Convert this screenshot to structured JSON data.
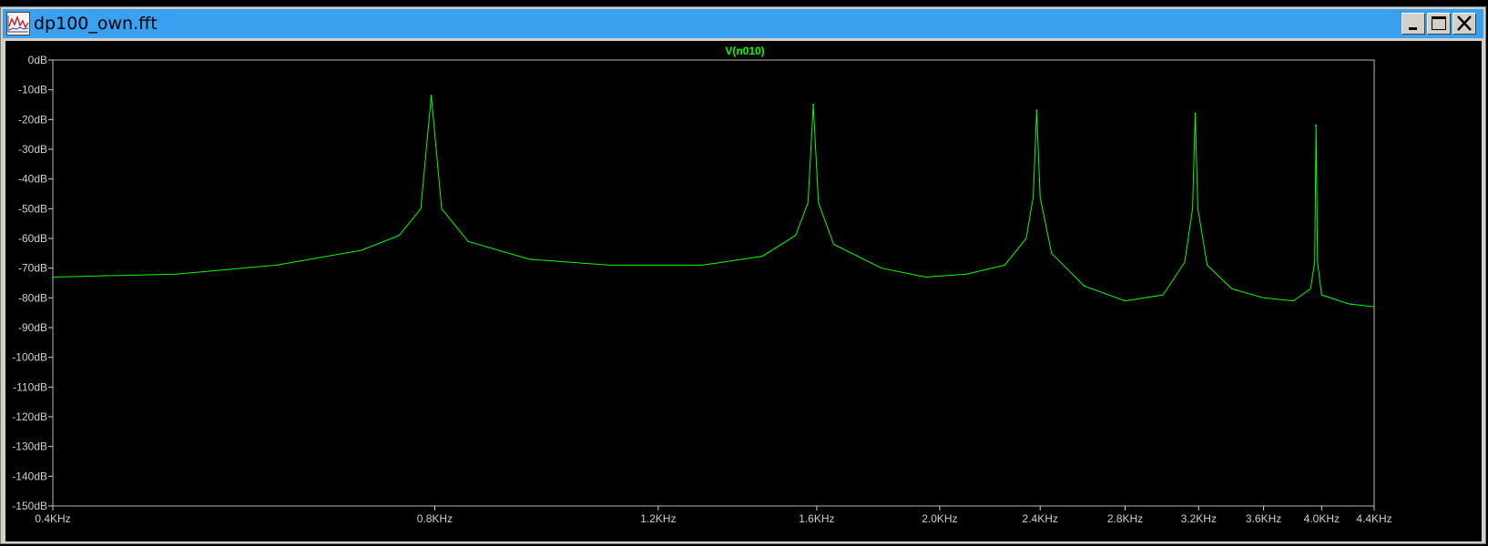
{
  "window": {
    "title": "dp100_own.fft",
    "buttons": {
      "minimize": "minimize",
      "maximize": "maximize",
      "close": "close"
    }
  },
  "colors": {
    "trace": "#00ff00",
    "axis": "#d0d0d0",
    "background": "#000000",
    "titlebar": "#3aa0f0"
  },
  "chart_data": {
    "type": "line",
    "title": "V(n010)",
    "xscale": "log",
    "xlim": [
      0.4,
      4.4
    ],
    "ylim": [
      -150,
      0
    ],
    "grid": false,
    "x_ticks": [
      {
        "value": 0.4,
        "label": "0.4KHz"
      },
      {
        "value": 0.8,
        "label": "0.8KHz"
      },
      {
        "value": 1.2,
        "label": "1.2KHz"
      },
      {
        "value": 1.6,
        "label": "1.6KHz"
      },
      {
        "value": 2.0,
        "label": "2.0KHz"
      },
      {
        "value": 2.4,
        "label": "2.4KHz"
      },
      {
        "value": 2.8,
        "label": "2.8KHz"
      },
      {
        "value": 3.2,
        "label": "3.2KHz"
      },
      {
        "value": 3.6,
        "label": "3.6KHz"
      },
      {
        "value": 4.0,
        "label": "4.0KHz"
      },
      {
        "value": 4.4,
        "label": "4.4KHz"
      }
    ],
    "y_ticks": [
      {
        "value": 0,
        "label": "0dB"
      },
      {
        "value": -10,
        "label": "-10dB"
      },
      {
        "value": -20,
        "label": "-20dB"
      },
      {
        "value": -30,
        "label": "-30dB"
      },
      {
        "value": -40,
        "label": "-40dB"
      },
      {
        "value": -50,
        "label": "-50dB"
      },
      {
        "value": -60,
        "label": "-60dB"
      },
      {
        "value": -70,
        "label": "-70dB"
      },
      {
        "value": -80,
        "label": "-80dB"
      },
      {
        "value": -90,
        "label": "-90dB"
      },
      {
        "value": -100,
        "label": "-100dB"
      },
      {
        "value": -110,
        "label": "-110dB"
      },
      {
        "value": -120,
        "label": "-120dB"
      },
      {
        "value": -130,
        "label": "-130dB"
      },
      {
        "value": -140,
        "label": "-140dB"
      },
      {
        "value": -150,
        "label": "-150dB"
      }
    ],
    "series": [
      {
        "name": "V(n010)",
        "peaks": [
          {
            "x": 0.795,
            "y": -12
          },
          {
            "x": 1.59,
            "y": -15
          },
          {
            "x": 2.385,
            "y": -17
          },
          {
            "x": 3.18,
            "y": -18
          },
          {
            "x": 3.96,
            "y": -22
          }
        ],
        "x": [
          0.4,
          0.5,
          0.6,
          0.7,
          0.75,
          0.78,
          0.795,
          0.81,
          0.85,
          0.95,
          1.1,
          1.3,
          1.45,
          1.54,
          1.575,
          1.59,
          1.605,
          1.65,
          1.8,
          1.95,
          2.1,
          2.25,
          2.34,
          2.37,
          2.385,
          2.4,
          2.45,
          2.6,
          2.8,
          3.0,
          3.12,
          3.165,
          3.18,
          3.195,
          3.25,
          3.4,
          3.6,
          3.8,
          3.92,
          3.95,
          3.96,
          3.97,
          4.0,
          4.2,
          4.4
        ],
        "y": [
          -73,
          -72,
          -69,
          -64,
          -59,
          -50,
          -12,
          -50,
          -61,
          -67,
          -69,
          -69,
          -66,
          -59,
          -48,
          -15,
          -48,
          -62,
          -70,
          -73,
          -72,
          -69,
          -60,
          -46,
          -17,
          -46,
          -65,
          -76,
          -81,
          -79,
          -68,
          -50,
          -18,
          -50,
          -69,
          -77,
          -80,
          -81,
          -77,
          -68,
          -22,
          -68,
          -79,
          -82,
          -83
        ]
      }
    ]
  }
}
